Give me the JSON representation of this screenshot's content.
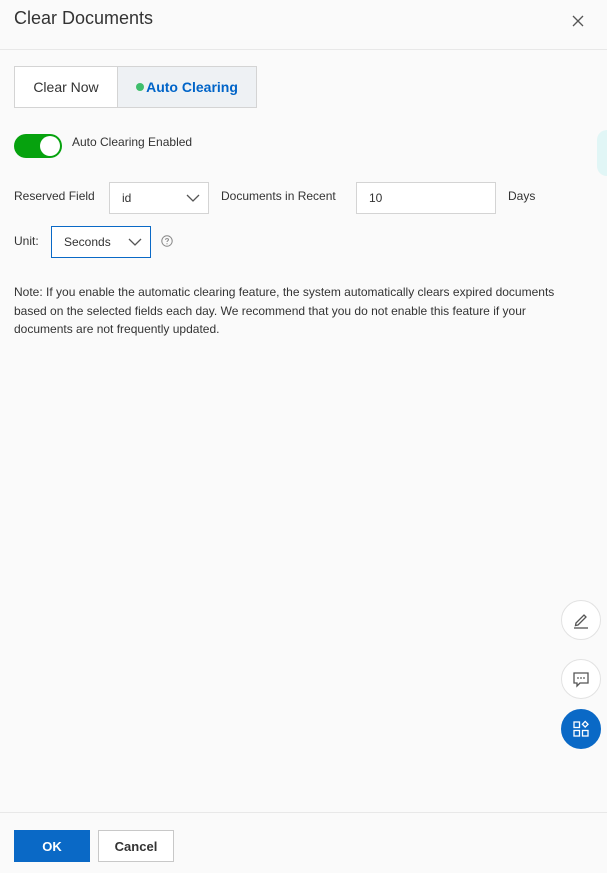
{
  "dialog": {
    "title": "Clear Documents"
  },
  "tabs": [
    {
      "label": "Clear Now",
      "active": false
    },
    {
      "label": "Auto Clearing",
      "active": true
    }
  ],
  "toggle": {
    "label": "Auto Clearing Enabled",
    "enabled": true
  },
  "reserved_field": {
    "label": "Reserved Field",
    "value": "id"
  },
  "recent": {
    "label": "Documents in Recent",
    "value": "10",
    "suffix": "Days"
  },
  "unit": {
    "label": "Unit:",
    "value": "Seconds"
  },
  "note": "Note: If you enable the automatic clearing feature, the system automatically clears expired documents based on the selected fields each day. We recommend that you do not enable this feature if your documents are not frequently updated.",
  "footer": {
    "ok_label": "OK",
    "cancel_label": "Cancel"
  },
  "colors": {
    "primary": "#0a69c6",
    "toggle_on": "#06a20e",
    "active_dot": "#3fbe6c"
  },
  "icons": [
    "close-icon",
    "chevron-down-icon",
    "help-icon",
    "edit-icon",
    "comment-icon",
    "apps-icon"
  ]
}
